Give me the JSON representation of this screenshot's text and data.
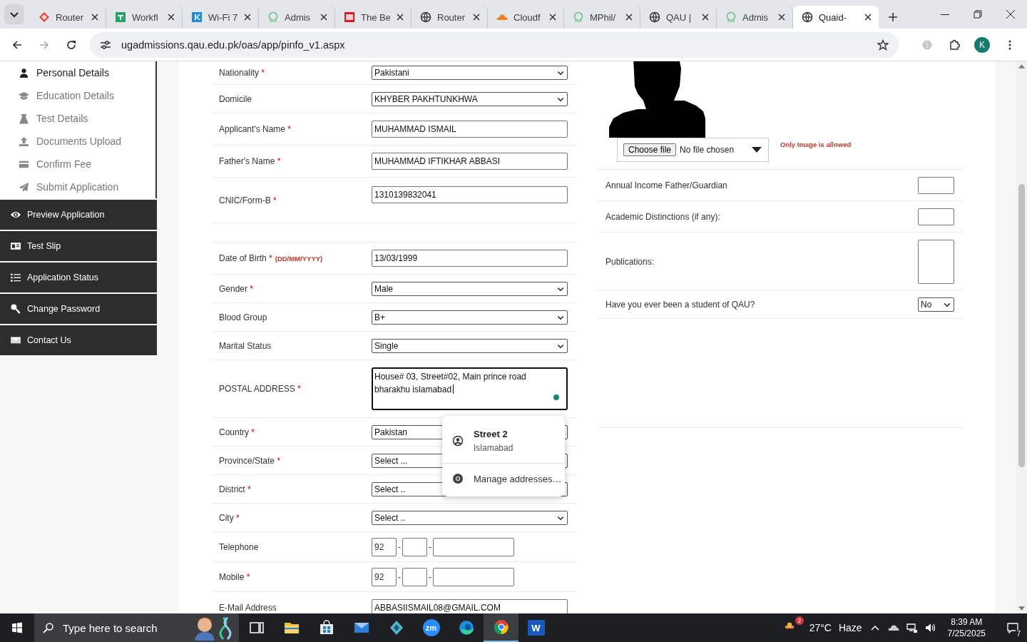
{
  "browser": {
    "tabs": [
      {
        "title": "Router",
        "kind": "diamond",
        "selected": false
      },
      {
        "title": "Workfl",
        "kind": "sheet",
        "selected": false
      },
      {
        "title": "Wi-Fi 7",
        "kind": "bluesquare",
        "selected": false
      },
      {
        "title": "Admis",
        "kind": "crest",
        "selected": false
      },
      {
        "title": "The Be",
        "kind": "redsquare",
        "selected": false
      },
      {
        "title": "Router",
        "kind": "globe",
        "selected": false
      },
      {
        "title": "Cloudf",
        "kind": "cloud",
        "selected": false
      },
      {
        "title": "MPhil/",
        "kind": "crest",
        "selected": false
      },
      {
        "title": "QAU |",
        "kind": "globe",
        "selected": false
      },
      {
        "title": "Admis",
        "kind": "crest",
        "selected": false
      },
      {
        "title": "Quaid-",
        "kind": "globe",
        "selected": true
      }
    ],
    "address": "ugadmissions.qau.edu.pk/oas/app/pinfo_v1.aspx",
    "profile_initial": "K"
  },
  "sidebar": {
    "steps": [
      {
        "label": "Personal Details",
        "kind": "user",
        "selected": true
      },
      {
        "label": "Education Details",
        "kind": "cap",
        "selected": false
      },
      {
        "label": "Test Details",
        "kind": "flask",
        "selected": false
      },
      {
        "label": "Documents Upload",
        "kind": "upload",
        "selected": false
      },
      {
        "label": "Confirm Fee",
        "kind": "card",
        "selected": false
      },
      {
        "label": "Submit Application",
        "kind": "send",
        "selected": false
      }
    ],
    "menu": [
      {
        "label": "Preview Application",
        "kind": "eye"
      },
      {
        "label": "Test Slip",
        "kind": "idcard"
      },
      {
        "label": "Application Status",
        "kind": "list"
      },
      {
        "label": "Change Password",
        "kind": "key"
      },
      {
        "label": "Contact Us",
        "kind": "mail"
      }
    ]
  },
  "form": {
    "rows": [
      {
        "label": "Nationality",
        "mark": "*",
        "kind": "select",
        "value": "Pakistani"
      },
      {
        "label": "Domicile",
        "kind": "select",
        "value": "KHYBER PAKHTUNKHWA"
      },
      {
        "label": "Applicant's Name",
        "mark": "*",
        "kind": "text",
        "value": "MUHAMMAD ISMAIL"
      },
      {
        "label": "Father's Name",
        "mark": "*",
        "kind": "text",
        "value": "MUHAMMAD IFTIKHAR ABBASI"
      },
      {
        "label": "CNIC/Form-B",
        "mark": "*",
        "kind": "cnic",
        "value": "1310139832041"
      },
      {
        "kind": "blank"
      },
      {
        "label": "Date of Birth",
        "mark": "*",
        "hint": "(DD/MM/YYYY)",
        "kind": "text",
        "value": "13/03/1999"
      },
      {
        "label": "Gender",
        "mark": "*",
        "kind": "select",
        "value": "Male"
      },
      {
        "label": "Blood Group",
        "kind": "select",
        "value": "B+"
      },
      {
        "label": "Marital Status",
        "kind": "select",
        "value": "Single"
      },
      {
        "label": "POSTAL ADDRESS",
        "mark": "*",
        "kind": "address",
        "value": "House# 03, Street#02, Main prince road bharakhu islamabad"
      },
      {
        "label": "Country",
        "mark": "*",
        "kind": "select",
        "value": "Pakistan"
      },
      {
        "label": "Province/State",
        "mark": "*",
        "kind": "select",
        "value": "Select ..."
      },
      {
        "label": "District",
        "mark": "*",
        "kind": "select",
        "value": "Select .."
      },
      {
        "label": "City",
        "mark": "*",
        "kind": "select",
        "value": "Select .."
      },
      {
        "label": "Telephone",
        "kind": "phone",
        "code": "92",
        "separators": [
          "-",
          "-"
        ]
      },
      {
        "label": "Mobile",
        "mark": "*",
        "kind": "phone",
        "code": "92",
        "separators": [
          "-",
          "-"
        ]
      },
      {
        "label": "E-Mail Address",
        "kind": "text",
        "value": "ABBASIISMAIL08@GMAIL.COM"
      }
    ]
  },
  "photo": {
    "file_button": "Choose file",
    "file_status": "No file chosen",
    "note": "Only Image is allowed"
  },
  "details": {
    "rows": [
      {
        "label": "Annual Income Father/Guardian",
        "kind": "text"
      },
      {
        "label": "Academic Distinctions (if any):",
        "kind": "text"
      },
      {
        "label": "Publications:",
        "kind": "textarea"
      },
      {
        "label": "Have you ever been a student of QAU?",
        "kind": "select",
        "value": "No"
      }
    ]
  },
  "autofill": {
    "title": "Street 2",
    "subtitle": "Islamabad",
    "manage": "Manage addresses…"
  },
  "taskbar": {
    "search_placeholder": "Type here to search",
    "apps": [
      {
        "kind": "taskview",
        "selected": false
      },
      {
        "kind": "folder",
        "selected": false
      },
      {
        "kind": "store",
        "selected": false
      },
      {
        "kind": "mail",
        "selected": false
      },
      {
        "kind": "app",
        "selected": false
      },
      {
        "kind": "zoom",
        "label": "zm",
        "selected": false
      },
      {
        "kind": "edge",
        "selected": false
      },
      {
        "kind": "chrome",
        "selected": true
      },
      {
        "kind": "word",
        "label": "W",
        "selected": false
      }
    ],
    "weather": {
      "badge": "2",
      "temp": "27°C",
      "condition": "Haze"
    },
    "time": "8:39 AM",
    "date": "7/25/2025",
    "notifications": "7"
  }
}
